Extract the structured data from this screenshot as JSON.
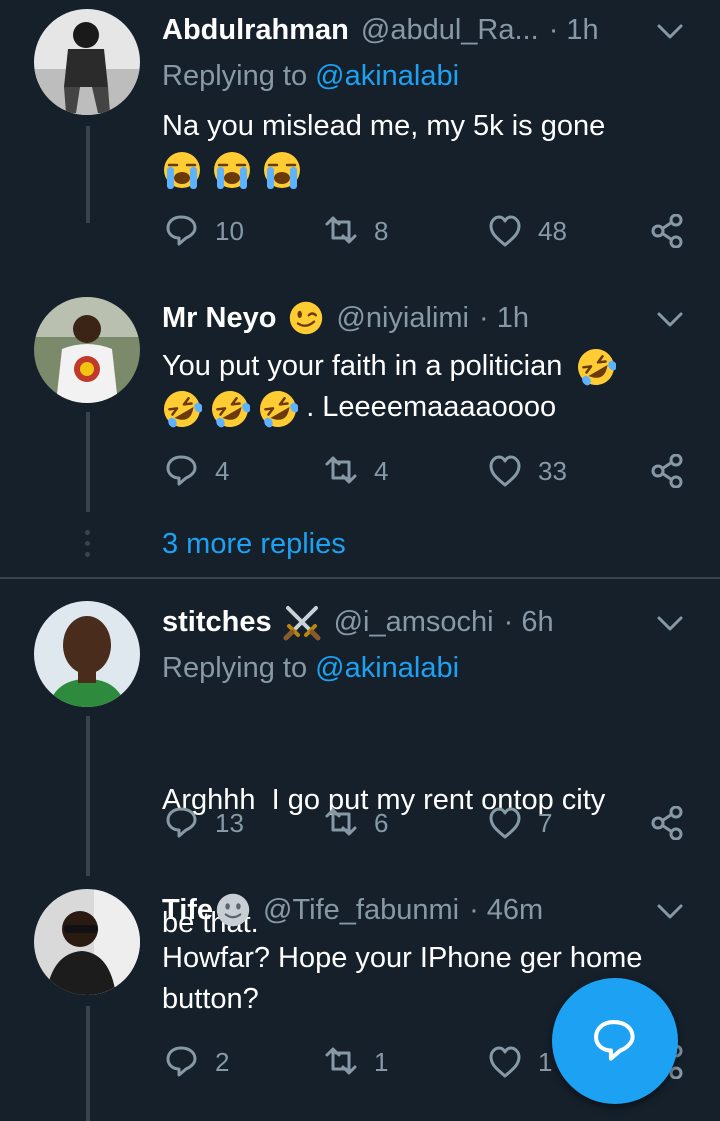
{
  "tweets": [
    {
      "name": "Abdulrahman",
      "handle": "@abdul_Ra...",
      "time": "· 1h",
      "replying_prefix": "Replying to ",
      "replying_mention": "@akinalabi",
      "text_line1": "Na you mislead me, my 5k is gone",
      "emojis_line2": [
        "loudly-crying-face",
        "loudly-crying-face",
        "loudly-crying-face"
      ],
      "replies": "10",
      "retweets": "8",
      "likes": "48"
    },
    {
      "name": "Mr Neyo",
      "name_emoji": "winking-face",
      "handle": "@niyialimi",
      "time": "· 1h",
      "text_line1": "You put your faith in a politician",
      "text_line2": ". Leeeemaaaaoooo",
      "emojis": [
        "rolling-on-floor-laughing",
        "rolling-on-floor-laughing",
        "rolling-on-floor-laughing",
        "rolling-on-floor-laughing"
      ],
      "replies": "4",
      "retweets": "4",
      "likes": "33"
    },
    {
      "name": "stitches",
      "name_emoji": "crossed-swords",
      "handle": "@i_amsochi",
      "time": "· 6h",
      "replying_prefix": "Replying to ",
      "replying_mention": "@akinalabi",
      "text_line1": "Arghhh  I go put my rent ontop city",
      "text_line2": "be that.",
      "replies": "13",
      "retweets": "6",
      "likes": "7"
    },
    {
      "name": "Tife",
      "name_emoji": "slightly-smiling-face",
      "handle": "@Tife_fabunmi",
      "time": "· 46m",
      "text_line1": "Howfar? Hope your IPhone ger home",
      "text_line2": "button?",
      "replies": "2",
      "retweets": "1",
      "likes": "1"
    }
  ],
  "more_replies": "3 more replies",
  "colors": {
    "background": "#15202b",
    "accent": "#1da1f2",
    "muted": "#8899a6",
    "line": "#38444d"
  },
  "icons": {
    "reply": "reply-bubble-icon",
    "retweet": "retweet-icon",
    "like": "heart-icon",
    "share": "share-icon",
    "menu": "chevron-down-icon",
    "compose": "compose-reply-icon"
  }
}
